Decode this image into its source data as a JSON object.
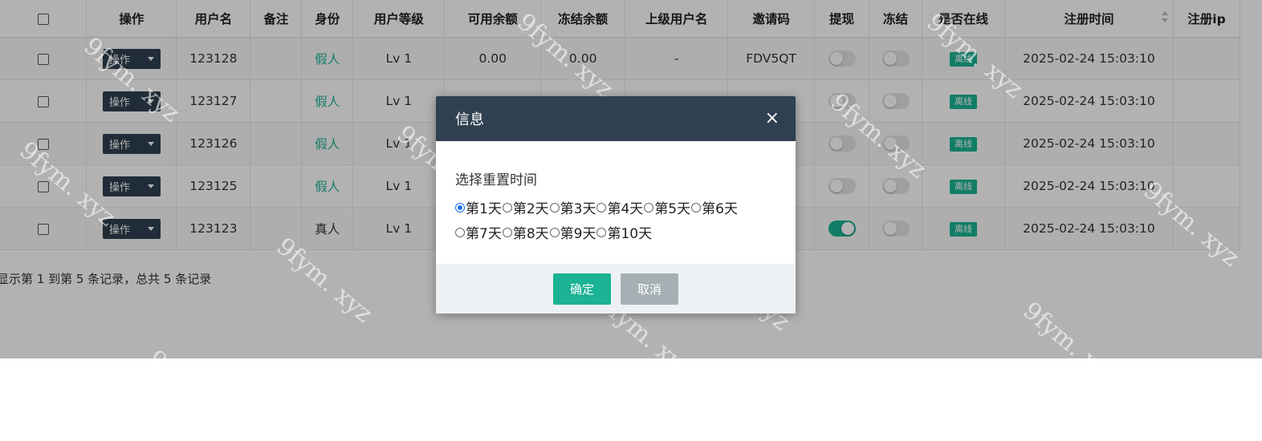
{
  "table": {
    "headers": [
      "",
      "操作",
      "用户名",
      "备注",
      "身份",
      "用户等级",
      "可用余额",
      "冻结余额",
      "上级用户名",
      "邀请码",
      "提现",
      "冻结",
      "是否在线",
      "注册时间",
      "注册ip"
    ],
    "op_label": "操作",
    "rows": [
      {
        "username": "123128",
        "note": "",
        "identity": "假人",
        "level": "Lv 1",
        "available": "0.00",
        "frozen": "0.00",
        "parent": "-",
        "invite": "FDV5QT",
        "withdraw_on": false,
        "freeze_on": false,
        "online": "离线",
        "reg_time": "2025-02-24 15:03:10",
        "reg_ip": ""
      },
      {
        "username": "123127",
        "note": "",
        "identity": "假人",
        "level": "Lv 1",
        "available": "",
        "frozen": "",
        "parent": "",
        "invite": "",
        "withdraw_on": false,
        "freeze_on": false,
        "online": "离线",
        "reg_time": "2025-02-24 15:03:10",
        "reg_ip": ""
      },
      {
        "username": "123126",
        "note": "",
        "identity": "假人",
        "level": "Lv 1",
        "available": "",
        "frozen": "",
        "parent": "",
        "invite": "",
        "withdraw_on": false,
        "freeze_on": false,
        "online": "离线",
        "reg_time": "2025-02-24 15:03:10",
        "reg_ip": ""
      },
      {
        "username": "123125",
        "note": "",
        "identity": "假人",
        "level": "Lv 1",
        "available": "",
        "frozen": "",
        "parent": "",
        "invite": "",
        "withdraw_on": false,
        "freeze_on": false,
        "online": "离线",
        "reg_time": "2025-02-24 15:03:10",
        "reg_ip": ""
      },
      {
        "username": "123123",
        "note": "",
        "identity": "真人",
        "level": "Lv 1",
        "available": "",
        "frozen": "",
        "parent": "",
        "invite": "",
        "withdraw_on": true,
        "freeze_on": false,
        "online": "离线",
        "reg_time": "2025-02-24 15:03:10",
        "reg_ip": ""
      }
    ]
  },
  "pager": {
    "summary": "显示第 1 到第 5 条记录，总共 5 条记录"
  },
  "watermark": {
    "text": "9fym. xyz"
  },
  "modal": {
    "title": "信息",
    "close": "×",
    "prompt": "选择重置时间",
    "options": [
      "第1天",
      "第2天",
      "第3天",
      "第4天",
      "第5天",
      "第6天",
      "第7天",
      "第8天",
      "第9天",
      "第10天"
    ],
    "selected_index": 0,
    "confirm": "确定",
    "cancel": "取消"
  },
  "colors": {
    "accent": "#1ab394",
    "header_dark": "#2f4050",
    "cancel_gray": "#a5b0b4"
  }
}
